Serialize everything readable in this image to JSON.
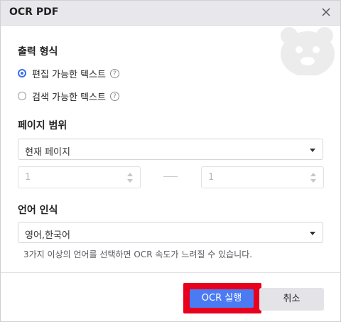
{
  "window": {
    "title": "OCR PDF"
  },
  "output_format": {
    "heading": "출력 형식",
    "options": [
      {
        "label": "편집 가능한 텍스트",
        "selected": true
      },
      {
        "label": "검색 가능한 텍스트",
        "selected": false
      }
    ],
    "help_glyph": "?"
  },
  "page_range": {
    "heading": "페이지 범위",
    "selected": "현재 페이지",
    "from_value": "1",
    "to_value": "1"
  },
  "language": {
    "heading": "언어 인식",
    "selected": "영어,한국어",
    "hint": "3가지 이상의 언어를 선택하면 OCR 속도가 느려질 수 있습니다."
  },
  "buttons": {
    "run": "OCR 실행",
    "cancel": "취소"
  },
  "colors": {
    "accent": "#4b7bf3",
    "highlight": "#e8001c",
    "titlebar": "#e8e8ec"
  },
  "icons": {
    "close": "close-icon",
    "help": "help-icon",
    "dropdown": "chevron-down-icon"
  }
}
